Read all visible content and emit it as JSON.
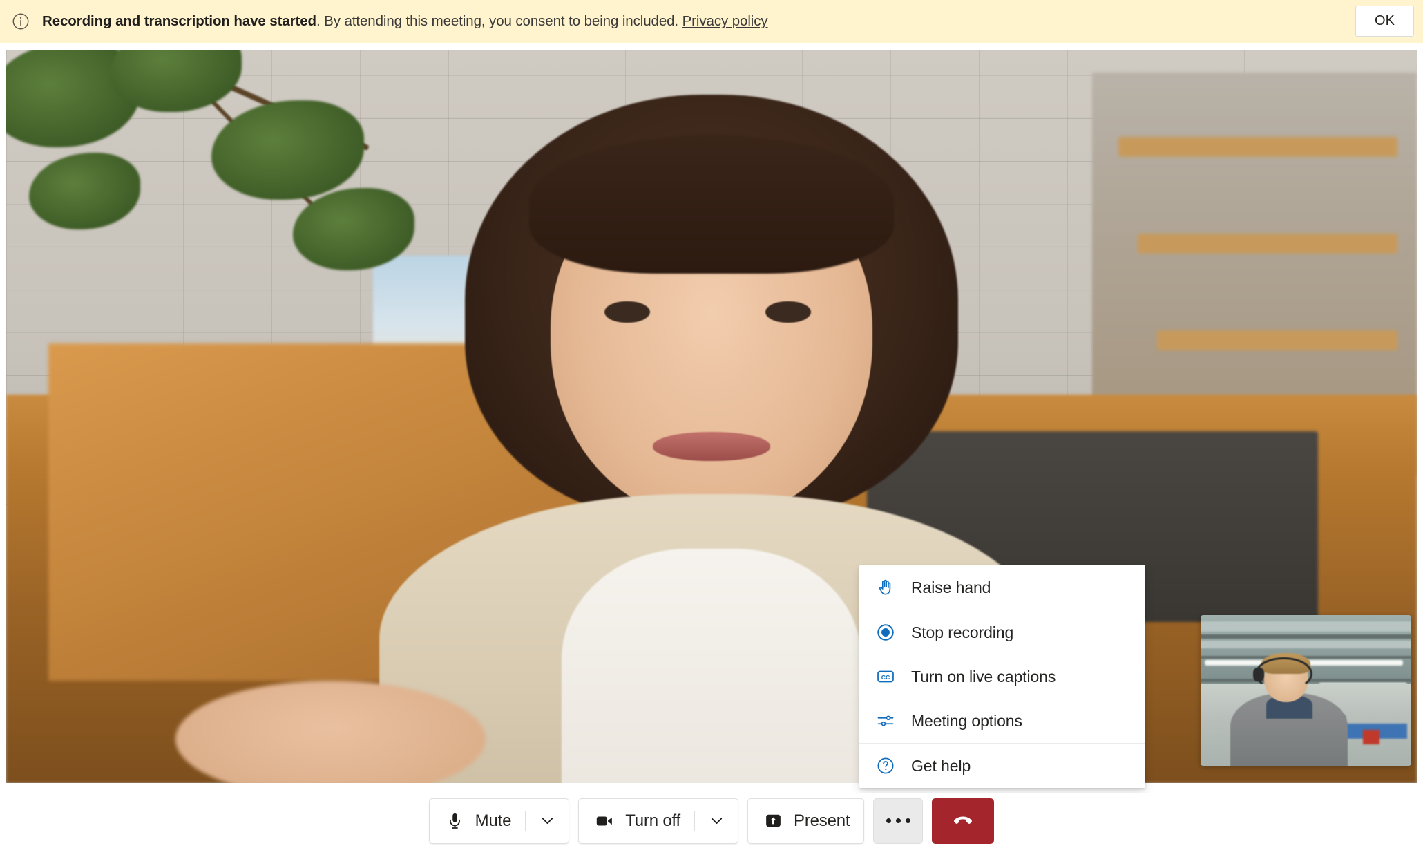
{
  "banner": {
    "icon": "info-icon",
    "message_bold": "Recording and transcription have started",
    "message_rest": ". By attending this meeting, you consent to being included. ",
    "link_label": "Privacy policy",
    "ok_label": "OK",
    "background_color": "#FFF4CE"
  },
  "stage": {
    "description": "Main speaker video — woman with short dark hair in an office with brick wall, plant and wooden desk",
    "self_view_description": "Self view — man with headset in an open industrial office"
  },
  "menu": {
    "accent_color": "#0078D4",
    "items": [
      {
        "label": "Raise hand",
        "icon": "raise-hand-icon",
        "separator_after": true
      },
      {
        "label": "Stop recording",
        "icon": "stop-recording-icon",
        "separator_after": false
      },
      {
        "label": "Turn on live captions",
        "icon": "closed-captions-icon",
        "separator_after": false
      },
      {
        "label": "Meeting options",
        "icon": "meeting-options-icon",
        "separator_after": true
      },
      {
        "label": "Get help",
        "icon": "help-circle-icon",
        "separator_after": false
      }
    ]
  },
  "toolbar": {
    "mute": {
      "label": "Mute",
      "icon": "microphone-icon",
      "caret": "chevron-down-icon"
    },
    "camera": {
      "label": "Turn off",
      "icon": "camera-icon",
      "caret": "chevron-down-icon"
    },
    "present": {
      "label": "Present",
      "icon": "share-screen-icon"
    },
    "more": {
      "label": "More actions",
      "icon": "ellipsis-icon",
      "active": true
    },
    "leave": {
      "label": "Leave",
      "icon": "hang-up-icon",
      "color": "#A4262C"
    }
  }
}
